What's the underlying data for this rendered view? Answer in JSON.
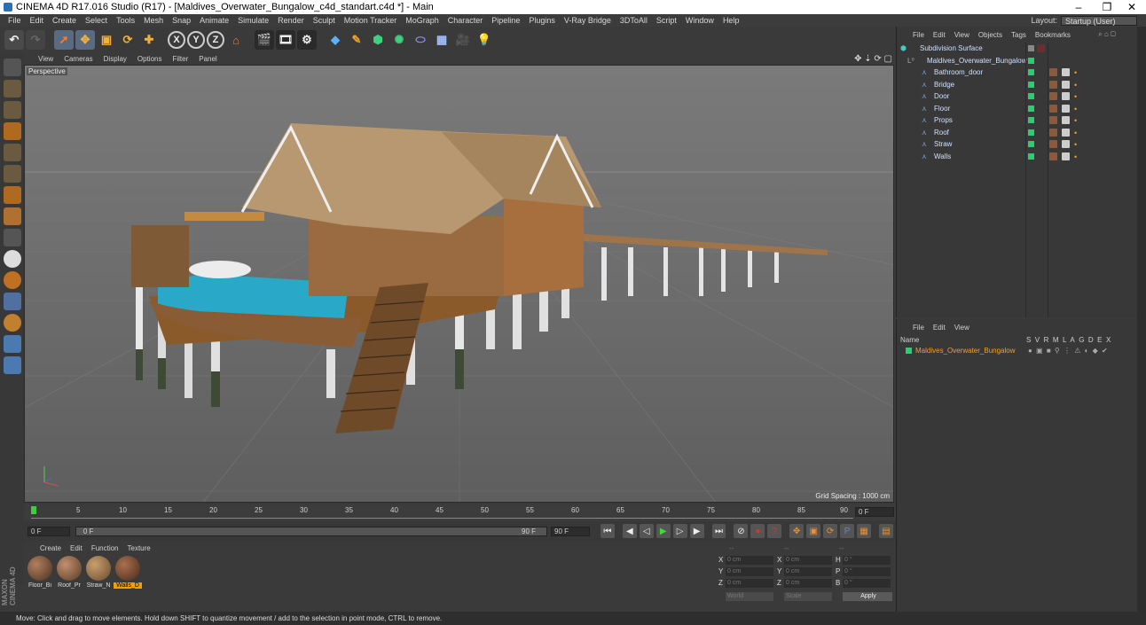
{
  "title": "CINEMA 4D R17.016 Studio (R17) - [Maldives_Overwater_Bungalow_c4d_standart.c4d *] - Main",
  "menu": [
    "File",
    "Edit",
    "Create",
    "Select",
    "Tools",
    "Mesh",
    "Snap",
    "Animate",
    "Simulate",
    "Render",
    "Sculpt",
    "Motion Tracker",
    "MoGraph",
    "Character",
    "Pipeline",
    "Plugins",
    "V-Ray Bridge",
    "3DToAll",
    "Script",
    "Window",
    "Help"
  ],
  "layout": {
    "label": "Layout:",
    "value": "Startup (User)"
  },
  "viewport": {
    "menu": [
      "View",
      "Cameras",
      "Display",
      "Options",
      "Filter",
      "Panel"
    ],
    "camera": "Perspective",
    "grid_spacing": "Grid Spacing : 1000 cm"
  },
  "timeline": {
    "ticks": [
      "0",
      "5",
      "10",
      "15",
      "20",
      "25",
      "30",
      "35",
      "40",
      "45",
      "50",
      "55",
      "60",
      "65",
      "70",
      "75",
      "80",
      "85",
      "90"
    ],
    "end_field": "0 F"
  },
  "playbar": {
    "start": "0 F",
    "current": "0 F",
    "range_end": "90 F",
    "end": "90 F"
  },
  "materials": {
    "menu": [
      "Create",
      "Edit",
      "Function",
      "Texture"
    ],
    "items": [
      {
        "label": "Floor_Bi",
        "active": false
      },
      {
        "label": "Roof_Pr",
        "active": false
      },
      {
        "label": "Straw_N",
        "active": false
      },
      {
        "label": "Walls_D",
        "active": true
      }
    ]
  },
  "coords": {
    "head": [
      "--",
      "--",
      "--"
    ],
    "rows": [
      {
        "a": "X",
        "av": "0 cm",
        "b": "X",
        "bv": "0 cm",
        "c": "H",
        "cv": "0 °"
      },
      {
        "a": "Y",
        "av": "0 cm",
        "b": "Y",
        "bv": "0 cm",
        "c": "P",
        "cv": "0 °"
      },
      {
        "a": "Z",
        "av": "0 cm",
        "b": "Z",
        "bv": "0 cm",
        "c": "B",
        "cv": "0 °"
      }
    ],
    "world": "World",
    "scale": "Scale",
    "apply": "Apply"
  },
  "status": "Move: Click and drag to move elements. Hold down SHIFT to quantize movement / add to the selection in point mode, CTRL to remove.",
  "object_manager": {
    "menu": [
      "File",
      "Edit",
      "View",
      "Objects",
      "Tags",
      "Bookmarks"
    ],
    "objects": [
      {
        "name": "Subdivision Surface",
        "level": 0
      },
      {
        "name": "Maldives_Overwater_Bungalow",
        "level": 1
      },
      {
        "name": "Bathroom_door",
        "level": 2
      },
      {
        "name": "Bridge",
        "level": 2
      },
      {
        "name": "Door",
        "level": 2
      },
      {
        "name": "Floor",
        "level": 2
      },
      {
        "name": "Props",
        "level": 2
      },
      {
        "name": "Roof",
        "level": 2
      },
      {
        "name": "Straw",
        "level": 2
      },
      {
        "name": "Walls",
        "level": 2
      }
    ]
  },
  "attribute_manager": {
    "menu": [
      "File",
      "Edit",
      "View"
    ],
    "columns": [
      "Name",
      "S",
      "V",
      "R",
      "M",
      "L",
      "A",
      "G",
      "D",
      "E",
      "X"
    ],
    "row": "Maldives_Overwater_Bungalow"
  },
  "brand": "MAXON CINEMA 4D"
}
